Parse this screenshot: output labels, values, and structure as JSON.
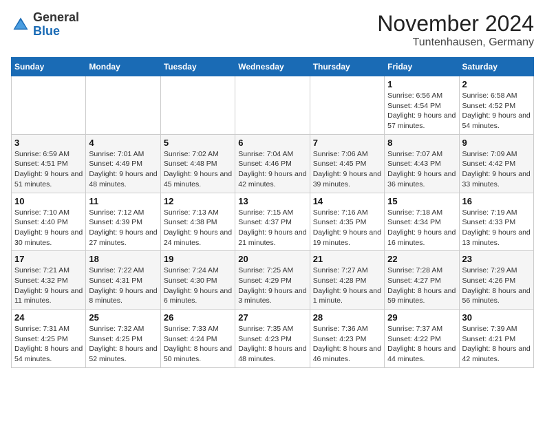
{
  "logo": {
    "general": "General",
    "blue": "Blue"
  },
  "header": {
    "month_year": "November 2024",
    "location": "Tuntenhausen, Germany"
  },
  "days_of_week": [
    "Sunday",
    "Monday",
    "Tuesday",
    "Wednesday",
    "Thursday",
    "Friday",
    "Saturday"
  ],
  "weeks": [
    {
      "days": [
        {
          "date": "",
          "info": ""
        },
        {
          "date": "",
          "info": ""
        },
        {
          "date": "",
          "info": ""
        },
        {
          "date": "",
          "info": ""
        },
        {
          "date": "",
          "info": ""
        },
        {
          "date": "1",
          "info": "Sunrise: 6:56 AM\nSunset: 4:54 PM\nDaylight: 9 hours and 57 minutes."
        },
        {
          "date": "2",
          "info": "Sunrise: 6:58 AM\nSunset: 4:52 PM\nDaylight: 9 hours and 54 minutes."
        }
      ]
    },
    {
      "days": [
        {
          "date": "3",
          "info": "Sunrise: 6:59 AM\nSunset: 4:51 PM\nDaylight: 9 hours and 51 minutes."
        },
        {
          "date": "4",
          "info": "Sunrise: 7:01 AM\nSunset: 4:49 PM\nDaylight: 9 hours and 48 minutes."
        },
        {
          "date": "5",
          "info": "Sunrise: 7:02 AM\nSunset: 4:48 PM\nDaylight: 9 hours and 45 minutes."
        },
        {
          "date": "6",
          "info": "Sunrise: 7:04 AM\nSunset: 4:46 PM\nDaylight: 9 hours and 42 minutes."
        },
        {
          "date": "7",
          "info": "Sunrise: 7:06 AM\nSunset: 4:45 PM\nDaylight: 9 hours and 39 minutes."
        },
        {
          "date": "8",
          "info": "Sunrise: 7:07 AM\nSunset: 4:43 PM\nDaylight: 9 hours and 36 minutes."
        },
        {
          "date": "9",
          "info": "Sunrise: 7:09 AM\nSunset: 4:42 PM\nDaylight: 9 hours and 33 minutes."
        }
      ]
    },
    {
      "days": [
        {
          "date": "10",
          "info": "Sunrise: 7:10 AM\nSunset: 4:40 PM\nDaylight: 9 hours and 30 minutes."
        },
        {
          "date": "11",
          "info": "Sunrise: 7:12 AM\nSunset: 4:39 PM\nDaylight: 9 hours and 27 minutes."
        },
        {
          "date": "12",
          "info": "Sunrise: 7:13 AM\nSunset: 4:38 PM\nDaylight: 9 hours and 24 minutes."
        },
        {
          "date": "13",
          "info": "Sunrise: 7:15 AM\nSunset: 4:37 PM\nDaylight: 9 hours and 21 minutes."
        },
        {
          "date": "14",
          "info": "Sunrise: 7:16 AM\nSunset: 4:35 PM\nDaylight: 9 hours and 19 minutes."
        },
        {
          "date": "15",
          "info": "Sunrise: 7:18 AM\nSunset: 4:34 PM\nDaylight: 9 hours and 16 minutes."
        },
        {
          "date": "16",
          "info": "Sunrise: 7:19 AM\nSunset: 4:33 PM\nDaylight: 9 hours and 13 minutes."
        }
      ]
    },
    {
      "days": [
        {
          "date": "17",
          "info": "Sunrise: 7:21 AM\nSunset: 4:32 PM\nDaylight: 9 hours and 11 minutes."
        },
        {
          "date": "18",
          "info": "Sunrise: 7:22 AM\nSunset: 4:31 PM\nDaylight: 9 hours and 8 minutes."
        },
        {
          "date": "19",
          "info": "Sunrise: 7:24 AM\nSunset: 4:30 PM\nDaylight: 9 hours and 6 minutes."
        },
        {
          "date": "20",
          "info": "Sunrise: 7:25 AM\nSunset: 4:29 PM\nDaylight: 9 hours and 3 minutes."
        },
        {
          "date": "21",
          "info": "Sunrise: 7:27 AM\nSunset: 4:28 PM\nDaylight: 9 hours and 1 minute."
        },
        {
          "date": "22",
          "info": "Sunrise: 7:28 AM\nSunset: 4:27 PM\nDaylight: 8 hours and 59 minutes."
        },
        {
          "date": "23",
          "info": "Sunrise: 7:29 AM\nSunset: 4:26 PM\nDaylight: 8 hours and 56 minutes."
        }
      ]
    },
    {
      "days": [
        {
          "date": "24",
          "info": "Sunrise: 7:31 AM\nSunset: 4:25 PM\nDaylight: 8 hours and 54 minutes."
        },
        {
          "date": "25",
          "info": "Sunrise: 7:32 AM\nSunset: 4:25 PM\nDaylight: 8 hours and 52 minutes."
        },
        {
          "date": "26",
          "info": "Sunrise: 7:33 AM\nSunset: 4:24 PM\nDaylight: 8 hours and 50 minutes."
        },
        {
          "date": "27",
          "info": "Sunrise: 7:35 AM\nSunset: 4:23 PM\nDaylight: 8 hours and 48 minutes."
        },
        {
          "date": "28",
          "info": "Sunrise: 7:36 AM\nSunset: 4:23 PM\nDaylight: 8 hours and 46 minutes."
        },
        {
          "date": "29",
          "info": "Sunrise: 7:37 AM\nSunset: 4:22 PM\nDaylight: 8 hours and 44 minutes."
        },
        {
          "date": "30",
          "info": "Sunrise: 7:39 AM\nSunset: 4:21 PM\nDaylight: 8 hours and 42 minutes."
        }
      ]
    }
  ]
}
